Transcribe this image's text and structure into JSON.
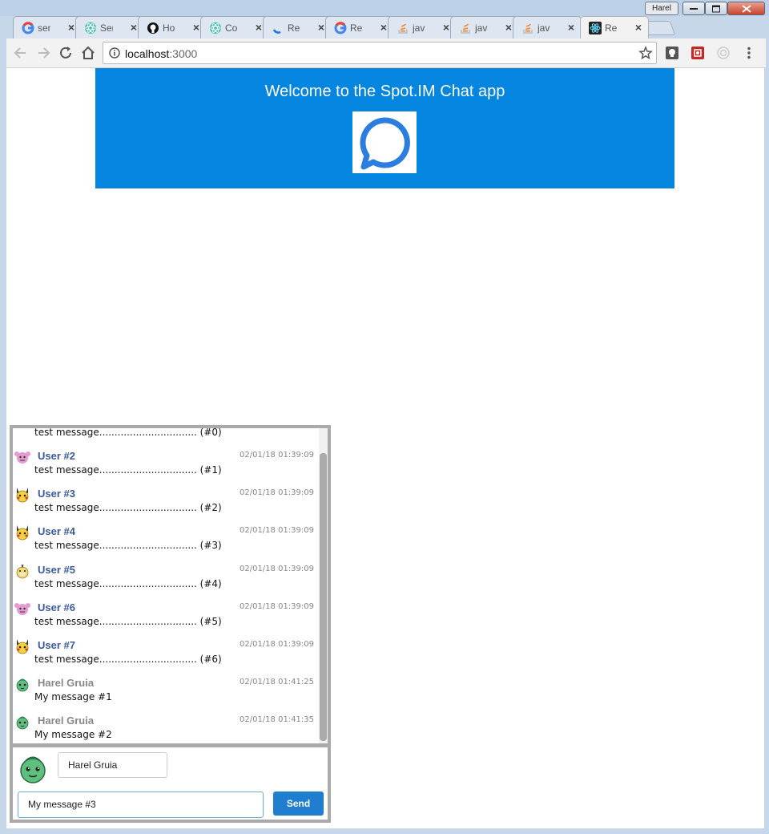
{
  "browser": {
    "profile_name": "Harel",
    "tabs": [
      {
        "title": "sen",
        "icon": "google-icon",
        "active": false
      },
      {
        "title": "Ser",
        "icon": "react-icon",
        "active": false
      },
      {
        "title": "Ho",
        "icon": "github-icon",
        "active": false
      },
      {
        "title": "Co",
        "icon": "react-icon",
        "active": false
      },
      {
        "title": "Rea",
        "icon": "loading-icon",
        "active": false
      },
      {
        "title": "Rea",
        "icon": "google-icon",
        "active": false
      },
      {
        "title": "java",
        "icon": "stackoverflow-icon",
        "active": false
      },
      {
        "title": "java",
        "icon": "stackoverflow-icon",
        "active": false
      },
      {
        "title": "java",
        "icon": "stackoverflow-icon",
        "active": false
      },
      {
        "title": "Rea",
        "icon": "react-icon",
        "active": true
      }
    ],
    "url_host": "localhost",
    "url_port": ":3000"
  },
  "banner": {
    "title": "Welcome to the Spot.IM Chat app",
    "logo_icon": "chat-bubble-icon",
    "color": "#0385e0"
  },
  "chat": {
    "messages": [
      {
        "username": "",
        "time": "",
        "text": "test message................................ (#0)",
        "avatar": ""
      },
      {
        "username": "User #2",
        "time": "02/01/18 01:39:09",
        "text": "test message................................ (#1)",
        "avatar": "pink-monster-icon"
      },
      {
        "username": "User #3",
        "time": "02/01/18 01:39:09",
        "text": "test message................................ (#2)",
        "avatar": "pikachu-icon"
      },
      {
        "username": "User #4",
        "time": "02/01/18 01:39:09",
        "text": "test message................................ (#3)",
        "avatar": "pikachu-icon"
      },
      {
        "username": "User #5",
        "time": "02/01/18 01:39:09",
        "text": "test message................................ (#4)",
        "avatar": "psyduck-icon"
      },
      {
        "username": "User #6",
        "time": "02/01/18 01:39:09",
        "text": "test message................................ (#5)",
        "avatar": "pink-monster-icon"
      },
      {
        "username": "User #7",
        "time": "02/01/18 01:39:09",
        "text": "test message................................ (#6)",
        "avatar": "pikachu-icon"
      },
      {
        "username": "Harel Gruia",
        "time": "02/01/18 01:41:25",
        "text": "My message #1",
        "avatar": "bulbasaur-icon"
      },
      {
        "username": "Harel Gruia",
        "time": "02/01/18 01:41:35",
        "text": "My message #2",
        "avatar": "bulbasaur-icon"
      }
    ],
    "composer": {
      "username_value": "Harel Gruia",
      "message_value": "My message #3",
      "send_label": "Send",
      "avatar": "bulbasaur-icon"
    }
  }
}
